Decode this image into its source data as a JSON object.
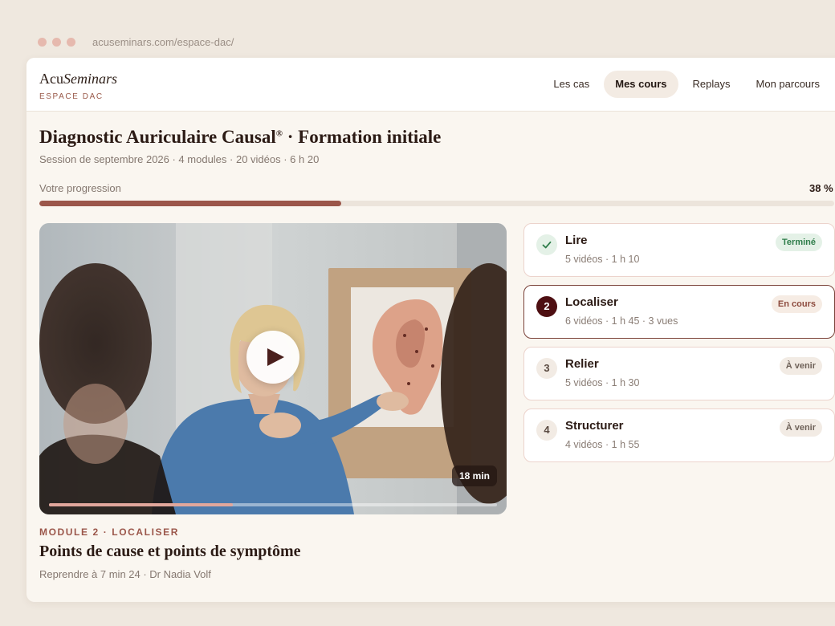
{
  "browser": {
    "url": "acuseminars.com/espace-dac/"
  },
  "brand": {
    "name_regular": "Acu",
    "name_italic": "Seminars",
    "subtitle": "ESPACE DAC"
  },
  "nav": {
    "tabs": [
      {
        "label": "Les cas"
      },
      {
        "label": "Mes cours",
        "active": true
      },
      {
        "label": "Replays"
      },
      {
        "label": "Mon parcours"
      }
    ]
  },
  "course": {
    "title": "Diagnostic Auriculaire Causal",
    "title_mark": "®",
    "title_suffix": " · Formation initiale",
    "meta": "Session de septembre 2026 · 4 modules · 20 vidéos · 6 h 20"
  },
  "progress": {
    "label": "Votre progression",
    "value_text": "38 %",
    "fraction": 0.38
  },
  "video": {
    "duration": "18 min",
    "played_fraction": 0.41,
    "module_eyebrow": "MODULE 2 · LOCALISER",
    "lesson_title": "Points de cause et points de symptôme",
    "resume_text": "Reprendre à 7 min 24 · Dr Nadia Volf"
  },
  "modules": [
    {
      "number": "1",
      "name": "Lire",
      "meta": "5 vidéos · 1 h 10",
      "status": "Terminé",
      "state": "done"
    },
    {
      "number": "2",
      "name": "Localiser",
      "meta": "6 vidéos · 1 h 45 · 3 vues",
      "status": "En cours",
      "state": "current"
    },
    {
      "number": "3",
      "name": "Relier",
      "meta": "5 vidéos · 1 h 30",
      "status": "À venir",
      "state": "upcoming"
    },
    {
      "number": "4",
      "name": "Structurer",
      "meta": "4 vidéos · 1 h 55",
      "status": "À venir",
      "state": "upcoming"
    }
  ],
  "colors": {
    "accent": "#9b564a",
    "current_module": "#4e0f12",
    "done_green": "#2e7d4a"
  },
  "icons": {
    "play": "play-icon",
    "check": "check-icon"
  }
}
